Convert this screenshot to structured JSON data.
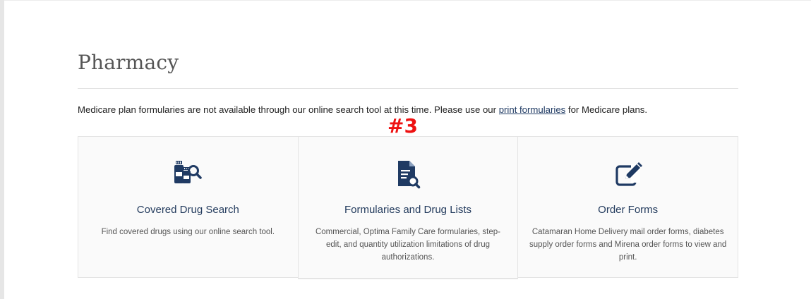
{
  "page": {
    "title": "Pharmacy",
    "notice_before": "Medicare plan formularies are not available through our online search tool at this time. Please use our ",
    "notice_link": "print formularies",
    "notice_after": " for Medicare plans.",
    "marker": "#3"
  },
  "colors": {
    "icon": "#1f3a63",
    "card_title": "#243c5e",
    "marker": "#ee1111",
    "card_bg": "#fafafa"
  },
  "cards": [
    {
      "icon": "pill-bottles-search-icon",
      "title": "Covered Drug Search",
      "description": "Find covered drugs using our online search tool."
    },
    {
      "icon": "document-search-icon",
      "title": "Formularies and Drug Lists",
      "description": "Commercial, Optima Family Care formularies, step-edit, and quantity utilization limitations of drug authorizations."
    },
    {
      "icon": "edit-form-icon",
      "title": "Order Forms",
      "description": "Catamaran Home Delivery mail order forms, diabetes supply order forms and Mirena order forms to view and print."
    }
  ]
}
